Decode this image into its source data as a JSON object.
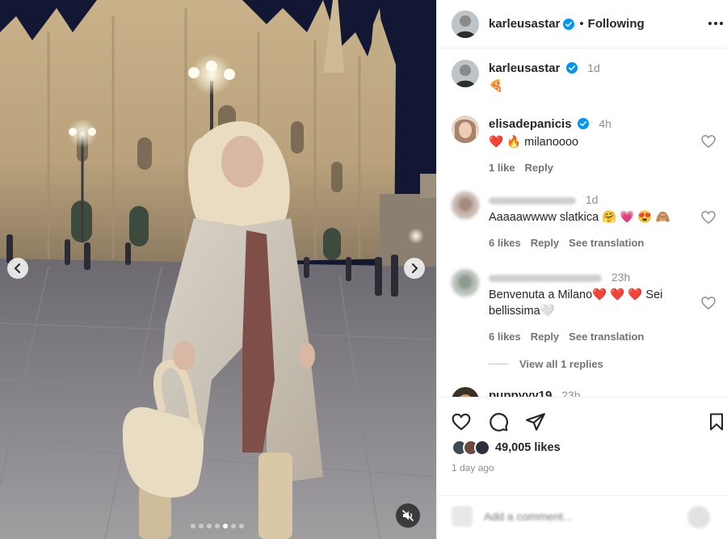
{
  "header": {
    "username": "karleusastar",
    "separator": "•",
    "follow_label": "Following"
  },
  "caption": {
    "username": "karleusastar",
    "time": "1d",
    "text": "🍕"
  },
  "comments": [
    {
      "username": "elisadepanicis",
      "verified": true,
      "time": "4h",
      "text": "❤️ 🔥  milanoooo",
      "likes": "1 like",
      "reply": "Reply"
    },
    {
      "username": "",
      "time": "1d",
      "text": "Aaaaawwww slatkica 🤗 💗 😍 🙈",
      "likes": "6 likes",
      "reply": "Reply",
      "translate": "See translation"
    },
    {
      "username": "",
      "time": "23h",
      "text": "Benvenuta a Milano❤️ ❤️ ❤️  Sei bellissima🤍",
      "likes": "6 likes",
      "reply": "Reply",
      "translate": "See translation",
      "view_replies": "View all 1 replies"
    },
    {
      "username": "puppyyy19",
      "time": "23h"
    }
  ],
  "stats": {
    "likes": "49,005 likes",
    "time_ago": "1 day ago"
  },
  "add_comment": {
    "placeholder": "Add a comment..."
  },
  "media": {
    "slides_total": 7,
    "active_slide": 5
  },
  "colors": {
    "verified_blue": "#0095f6",
    "text_primary": "#262626",
    "text_secondary": "#8e8e8e",
    "divider": "#efefef"
  },
  "icons": [
    "verified-badge-icon",
    "more-options-icon",
    "heart-icon",
    "comment-icon",
    "share-icon",
    "bookmark-icon",
    "chevron-left-icon",
    "chevron-right-icon",
    "muted-speaker-icon"
  ]
}
